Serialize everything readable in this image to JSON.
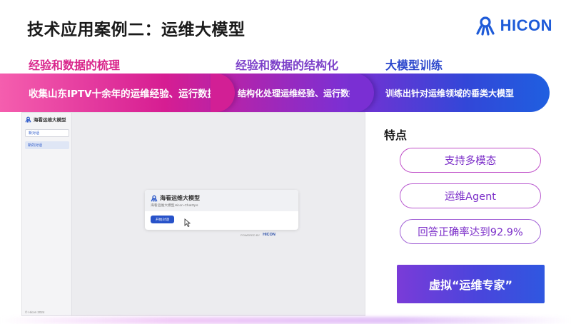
{
  "slide": {
    "title": "技术应用案例二：运维大模型",
    "logo_text": "HICON"
  },
  "steps": [
    {
      "heading": "经验和数据的梳理",
      "text": "收集山东IPTV十余年的运维经验、运行数据"
    },
    {
      "heading": "经验和数据的结构化",
      "text": "结构化处理运维经验、运行数据"
    },
    {
      "heading": "大模型训练",
      "text": "训练出针对运维领域的垂类大模型"
    }
  ],
  "screenshot": {
    "brand": "海看运维大模型",
    "sidebar": [
      "新对话",
      "新的对话"
    ],
    "footer": "© Hicon 2024",
    "card_title": "海看运维大模型",
    "card_subtitle": "海看运维大模型Hicon-ChatOps",
    "card_button": "开始对话",
    "powered_label": "POWERED BY",
    "powered_brand": "HICON"
  },
  "features": {
    "title": "特点",
    "items": [
      "支持多模态",
      "运维Agent",
      "回答正确率达到92.9%"
    ]
  },
  "cta": {
    "label": "虚拟“运维专家”"
  },
  "icons": {
    "logo": "hicon-octopus-icon",
    "cursor": "mouse-pointer-icon"
  },
  "colors": {
    "brand_blue": "#1e5bd8",
    "magenta": "#d61d92",
    "purple": "#7b3fc9"
  }
}
